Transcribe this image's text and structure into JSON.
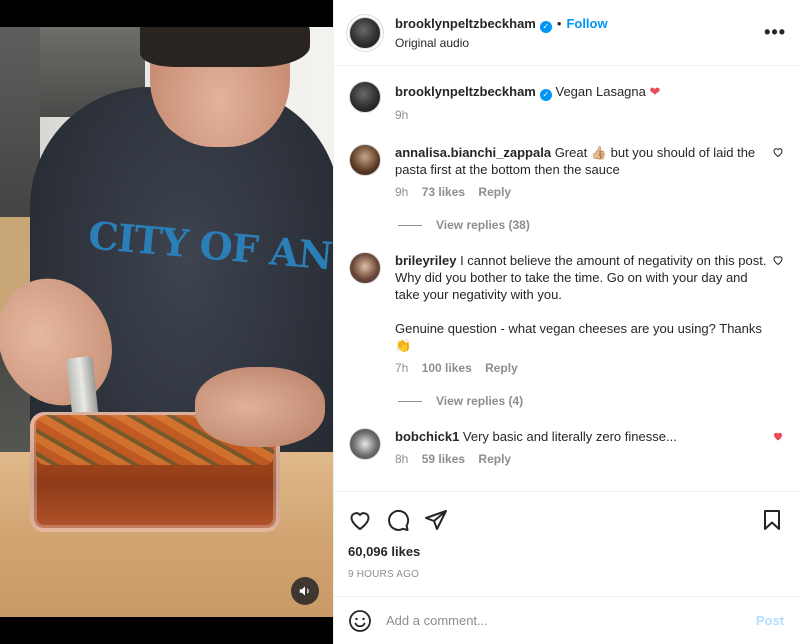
{
  "header": {
    "username": "brooklynpeltzbeckham",
    "verified_mark": "✓",
    "separator": "•",
    "follow_label": "Follow",
    "subtitle": "Original audio",
    "more_label": "•••"
  },
  "caption": {
    "username": "brooklynpeltzbeckham",
    "text": "Vegan Lasagna",
    "emoji": "❤",
    "time": "9h"
  },
  "media": {
    "shirt_text": "CITY OF ANGELS",
    "mute_icon": "speaker-icon"
  },
  "comments": [
    {
      "username": "annalisa.bianchi_zappala",
      "text": "Great 👍🏼 but you should of laid the pasta first at the bottom then the sauce",
      "time": "9h",
      "likes": "73 likes",
      "reply_label": "Reply",
      "view_replies": "View replies (38)",
      "liked": false
    },
    {
      "username": "brileyriley",
      "text": "I cannot believe the amount of negativity on this post. Why did you bother to take the time. Go on with your day and take your negativity with you.",
      "text2": "Genuine question - what vegan cheeses are you using? Thanks",
      "emoji": "👏",
      "time": "7h",
      "likes": "100 likes",
      "reply_label": "Reply",
      "view_replies": "View replies (4)",
      "liked": false
    },
    {
      "username": "bobchick1",
      "text": "Very basic and literally zero finesse...",
      "time": "8h",
      "likes": "59 likes",
      "reply_label": "Reply",
      "liked": true
    }
  ],
  "actions": {
    "likes": "60,096 likes",
    "timestamp": "9 HOURS AGO"
  },
  "add_comment": {
    "placeholder": "Add a comment...",
    "post_label": "Post"
  },
  "colors": {
    "accent": "#0095f6",
    "like_red": "#ed4956",
    "muted": "#8e8e8e"
  }
}
